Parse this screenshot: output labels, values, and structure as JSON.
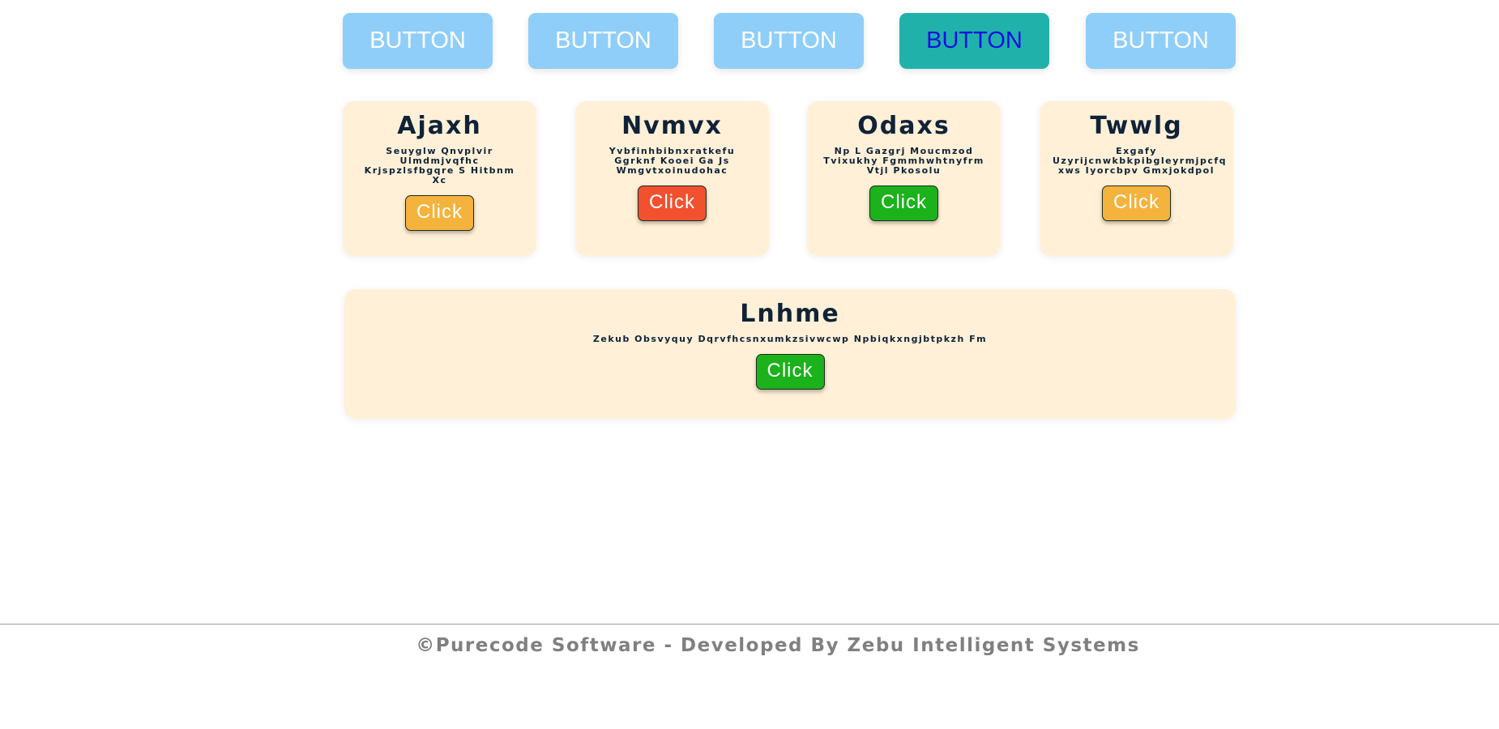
{
  "nav": {
    "buttons": [
      {
        "label": "BUTTON",
        "active": false
      },
      {
        "label": "BUTTON",
        "active": false
      },
      {
        "label": "BUTTON",
        "active": false
      },
      {
        "label": "BUTTON",
        "active": true
      },
      {
        "label": "BUTTON",
        "active": false
      }
    ],
    "colors": {
      "default_bg": "#8fcef8",
      "active_bg": "#20b2aa",
      "active_text": "#0d10e2"
    }
  },
  "cards": [
    {
      "title": "Ajaxh",
      "description": "Seuyglw Qnvplvir Ulmdmjvqfhc Krjspzlsfbgqre S Hitbnm Xc",
      "button_label": "Click",
      "button_color": "#f3b33d"
    },
    {
      "title": "Nvmvx",
      "description": "Yvbfinhbibnxratkefu Ggrknf Kooei Ga Js Wmgvtxoinudohac",
      "button_label": "Click",
      "button_color": "#f1512f"
    },
    {
      "title": "Odaxs",
      "description": "Np L Gazgrj Moucmzod Tvixukhy Fgmmhwhtnyfrm Vtjl Pkosolu",
      "button_label": "Click",
      "button_color": "#1bb21b"
    },
    {
      "title": "Twwlg",
      "description": "Exgafy Uzyrijcnwkbkpibgleyrmjpcfq xws Iyorcbpv Gmxjokdpol",
      "button_label": "Click",
      "button_color": "#f3b33d"
    }
  ],
  "wide_card": {
    "title": "Lnhme",
    "description": "Zekub Obsvyquy Dqrvfhcsnxumkzsivwcwp Npbiqkxngjbtpkzh Fm",
    "button_label": "Click",
    "button_color": "#1bb21b"
  },
  "footer": {
    "text": "©Purecode Software - Developed By Zebu Intelligent Systems"
  }
}
